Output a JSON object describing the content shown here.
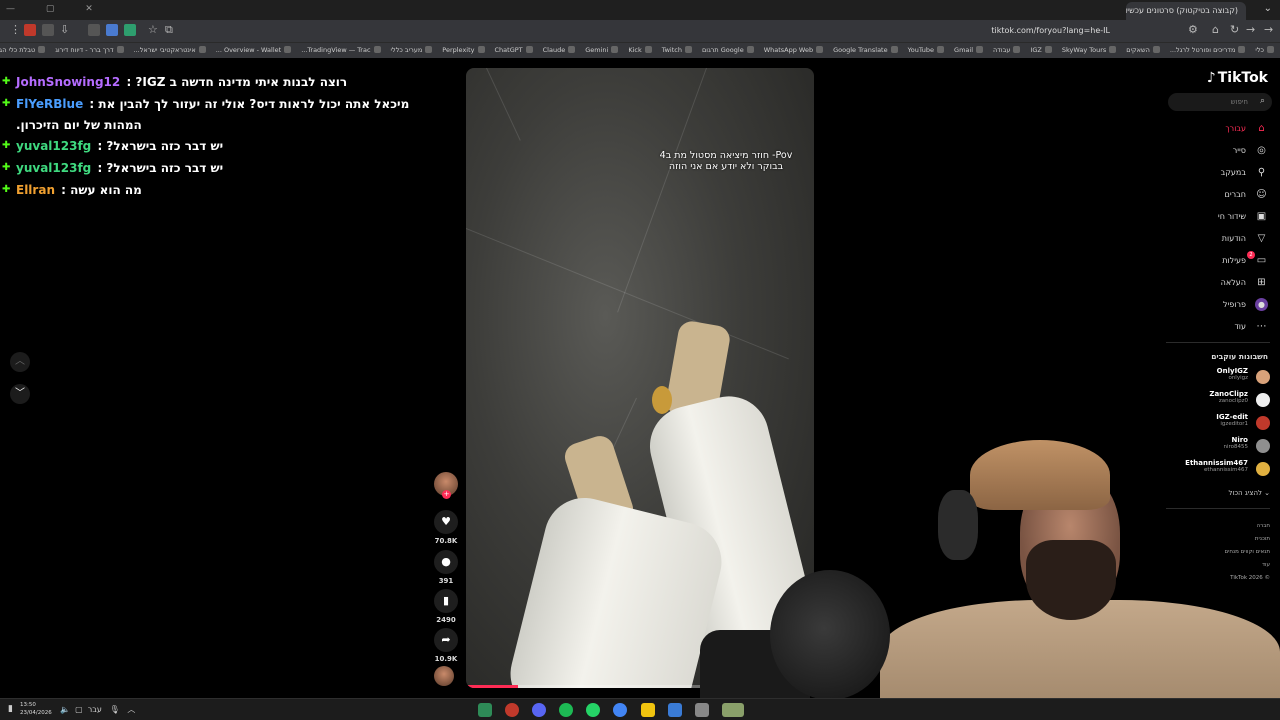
{
  "browser": {
    "tab_title": "(קבוצה בטיקטוק) סרטונים עכשיו | TikTok",
    "address": "tiktok.com/foryou?lang=he-IL",
    "bookmarks": [
      "כלי",
      "מדריכים ופורטל לרגל...",
      "השאקים",
      "SkyWay Tours",
      "IGZ",
      "עבודה",
      "Gmail",
      "YouTube",
      "Google Translate",
      "WhatsApp Web",
      "Google תרגום",
      "Twitch",
      "Kick",
      "Gemini",
      "Claude",
      "ChatGPT",
      "Perplexity",
      "מעריב כללי",
      "TradingView — Trac...",
      "Overview - Wallet ...",
      "אינטראקטיבי ישראל...",
      "דרך ברר - דיווח דירוג",
      "טבלת כלי הבינה המ..."
    ]
  },
  "chat": {
    "messages": [
      {
        "user": "JohnSnowing12",
        "text": "רוצה לבנות איתי מדינה חדשה ב IGZ?"
      },
      {
        "user": "FlYeRBlue",
        "text": "מיכאל אתה יכול לראות דיס? אולי זה יעזור לך להבין את המהות של יום הזיכרון."
      },
      {
        "user": "yuval123fg",
        "text": "יש דבר כזה בישראל?"
      },
      {
        "user": "yuval123fg",
        "text": "יש דבר כזה בישראל?"
      },
      {
        "user": "Ellran",
        "text": "מה הוא עשה"
      }
    ]
  },
  "video": {
    "caption": "Pov- חוזר מיציאה מסטול מת ב4 בבוקר ולא יודע אם אני הוזה",
    "progress": 0.15
  },
  "actions": {
    "likes": "70.8K",
    "comments": "391",
    "saves": "2490",
    "shares": "10.9K"
  },
  "tiktok": {
    "logo": "TikTok",
    "search_placeholder": "חיפוש",
    "nav": [
      {
        "label": "עבורך",
        "icon": "home-icon",
        "active": true
      },
      {
        "label": "סייר",
        "icon": "compass-icon"
      },
      {
        "label": "במעקב",
        "icon": "following-icon"
      },
      {
        "label": "חברים",
        "icon": "friends-icon"
      },
      {
        "label": "שידור חי",
        "icon": "live-icon"
      },
      {
        "label": "הודעות",
        "icon": "messages-icon"
      },
      {
        "label": "פעילות",
        "icon": "activity-icon",
        "badge": "2"
      },
      {
        "label": "העלאה",
        "icon": "upload-icon"
      },
      {
        "label": "פרופיל",
        "icon": "profile-icon"
      },
      {
        "label": "עוד",
        "icon": "more-icon"
      }
    ],
    "following_title": "חשבונות עוקבים",
    "following": [
      {
        "name": "OnlyIGZ",
        "handle": "onlyigz",
        "color": "#d9a27a"
      },
      {
        "name": "ZanoClipz",
        "handle": "zanoclipz0",
        "color": "#eeeeee"
      },
      {
        "name": "IGZ-edit",
        "handle": "igzeditor1",
        "color": "#c0392b"
      },
      {
        "name": "Niro",
        "handle": "niro8455",
        "color": "#8f8f8f"
      },
      {
        "name": "Ethannissim467",
        "handle": "ethannissim467",
        "color": "#e0b040"
      }
    ],
    "show_all": "להציג הכול",
    "footer": [
      "חברה",
      "תוכנית",
      "תנאים וקווים מנחים",
      "עוד",
      "TikTok 2026 ©"
    ]
  },
  "taskbar": {
    "time": "13:50",
    "date": "23/04/2026",
    "lang": "עבר"
  }
}
